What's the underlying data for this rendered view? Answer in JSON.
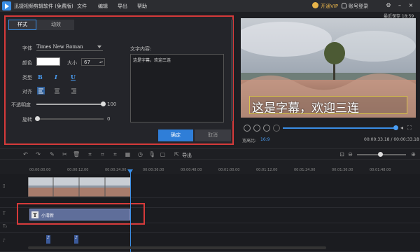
{
  "app": {
    "title": "迅捷视频剪辑软件 (免费版)",
    "menu": [
      "文件",
      "编辑",
      "导出",
      "帮助"
    ],
    "vip": "开通VIP",
    "login": "账号登录"
  },
  "panel": {
    "tabs": [
      "样式",
      "动效"
    ],
    "font_label": "字体",
    "font_value": "Times New Roman",
    "color_label": "颜色",
    "size_label": "大小",
    "size_value": "67",
    "type_label": "类型",
    "type_buttons": [
      "B",
      "I",
      "U"
    ],
    "align_label": "对齐",
    "opacity_label": "不透明度",
    "opacity_value": "100",
    "rotate_label": "旋转",
    "rotate_value": "0",
    "text_label": "文字内容:",
    "text_value": "这是字幕，欢迎三连",
    "ok": "确定",
    "cancel": "取消"
  },
  "preview": {
    "save_status": "最近保存 18:59",
    "subtitle": "这是字幕，欢迎三连",
    "ratio_label": "宽高比:",
    "ratio_value": "16:9",
    "time": "00:00:33.18 / 00:00:33.18"
  },
  "toolbar": {
    "export": "导出"
  },
  "ruler": {
    "ticks": [
      "00:00:00.00",
      "00:00:12.00",
      "00:00:24.00",
      "00:00:36.00",
      "00:00:48.00",
      "00:01:00.00",
      "00:01:12.00",
      "00:01:24.00",
      "00:01:36.00",
      "00:01:48.00"
    ]
  },
  "tracks": {
    "text_clip_label": "小清新",
    "track_labels": [
      "T",
      "T₂",
      "♪"
    ]
  },
  "colors": {
    "accent": "#3a8ee6",
    "highlight": "#d63a3a"
  }
}
